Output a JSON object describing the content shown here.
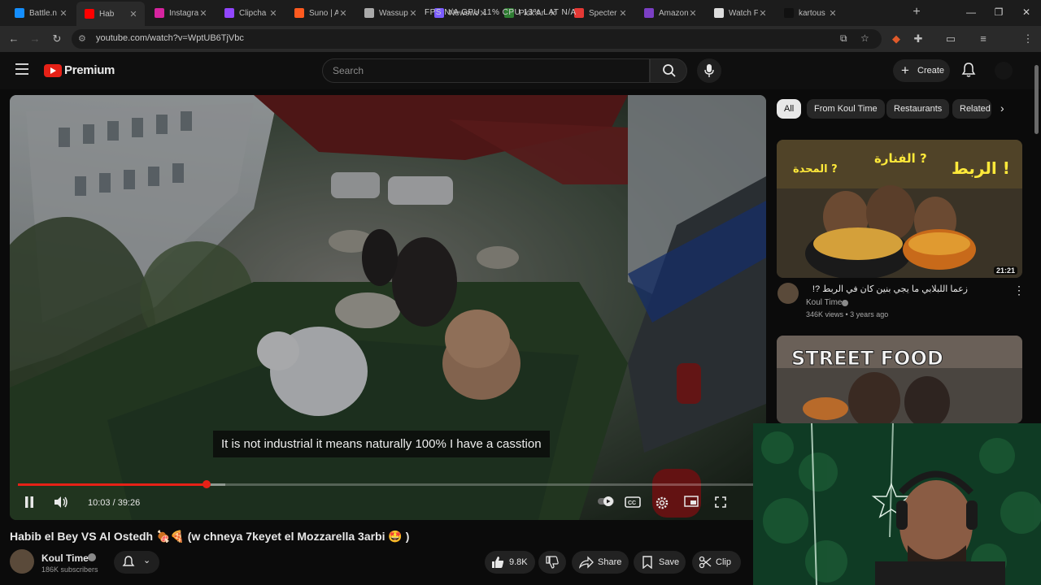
{
  "browser": {
    "tabs": [
      {
        "label": "Battle.n",
        "color": "#148eff",
        "active": false
      },
      {
        "label": "Hab",
        "color": "#ff0000",
        "active": true
      },
      {
        "label": "Instagra",
        "color": "#d6249f",
        "active": false
      },
      {
        "label": "Clipcha",
        "color": "#9146ff",
        "active": false
      },
      {
        "label": "Suno | A",
        "color": "#ff5a1f",
        "active": false
      },
      {
        "label": "Wassup",
        "color": "#aaaaaa",
        "active": false
      },
      {
        "label": "Newswa",
        "color": "#7b5cff",
        "active": false
      },
      {
        "label": "Pick Ar",
        "color": "#2e7d32",
        "active": false
      },
      {
        "label": "Specter",
        "color": "#e53935",
        "active": false
      },
      {
        "label": "Amazon",
        "color": "#7b3fc4",
        "active": false
      },
      {
        "label": "Watch F",
        "color": "#dddddd",
        "active": false
      },
      {
        "label": "kartous",
        "color": "#111111",
        "active": false
      }
    ],
    "overlay_stats": "FPS  N/A    GPU  11%    CPU  13%    LAT  N/A",
    "url": "youtube.com/watch?v=WptUB6TjVbc",
    "profile_initial": "I"
  },
  "masthead": {
    "logo_text": "Premium",
    "search_placeholder": "Search",
    "create_label": "Create"
  },
  "player": {
    "caption": "It is not industrial it means naturally 100% I have a casstion",
    "time_current": "10:03",
    "time_total": "39:26",
    "time_display": "10:03 / 39:26",
    "progress_fraction": 0.2549,
    "buffer_fraction": 0.28
  },
  "video": {
    "title": "Habib el Bey VS Al Ostedh 🍖🍕 (w chneya 7keyet el Mozzarella 3arbi 🤩 )",
    "channel": "Koul Time",
    "subscribers": "186K subscribers",
    "likes": "9.8K",
    "share_label": "Share",
    "save_label": "Save",
    "clip_label": "Clip"
  },
  "sidebar": {
    "chips": [
      "All",
      "From Koul Time",
      "Restaurants",
      "Related"
    ],
    "recommendations": [
      {
        "title": "زعما اللبلابي ما يجي بنين كان في الربط ?!",
        "channel": "Koul Time",
        "meta": "346K views • 3 years ago",
        "duration": "21:21",
        "thumb_texts": [
          "الربط !",
          "الفنارة ?",
          "المحدة ?"
        ]
      },
      {
        "thumb_texts": [
          "STREET FOOD"
        ]
      }
    ]
  },
  "colors": {
    "accent": "#e62117",
    "background": "#0f0f0f",
    "chip_bg": "#272727"
  }
}
